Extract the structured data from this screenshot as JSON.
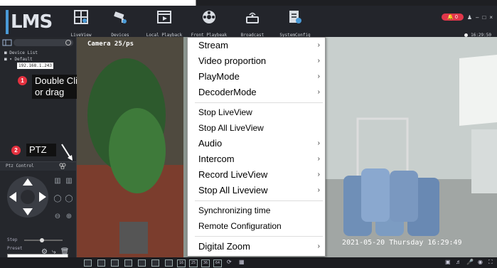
{
  "app": {
    "nav": [
      {
        "label": "LiveView",
        "icon": "liveview-icon"
      },
      {
        "label": "Devices",
        "icon": "camera-devices-icon"
      },
      {
        "label": "Local Playback",
        "icon": "local-playback-icon"
      },
      {
        "label": "Front Playbeak",
        "icon": "front-playback-icon"
      },
      {
        "label": "Broadcast",
        "icon": "broadcast-icon"
      },
      {
        "label": "SystemConfig",
        "icon": "system-config-icon"
      }
    ],
    "alarm_count": "0",
    "clock": "16:29:50"
  },
  "left": {
    "tree_title": "Device List",
    "tree_group": "Default",
    "device_ip": "192.168.1.243",
    "tip1_badge": "1",
    "tip1_text_line1": "Double Click",
    "tip1_text_line2": "or drag",
    "tip2_badge": "2",
    "tip2_text": "PTZ",
    "ptz_title": "Ptz Control",
    "step_label": "Step",
    "preset_label": "Preset"
  },
  "video": {
    "camera_label": "Camera 25/ps",
    "timestamp": "2021-05-20 Thursday 16:29:49"
  },
  "menu": {
    "items": [
      {
        "label": "Stream",
        "submenu": true
      },
      {
        "label": "Video proportion",
        "submenu": true
      },
      {
        "label": "PlayMode",
        "submenu": true
      },
      {
        "label": "DecoderMode",
        "submenu": true
      },
      {
        "label": "Stop LiveView",
        "submenu": false
      },
      {
        "label": "Stop All LiveView",
        "submenu": false
      },
      {
        "label": "Audio",
        "submenu": true
      },
      {
        "label": "Intercom",
        "submenu": true
      },
      {
        "label": "Record LiveView",
        "submenu": true
      },
      {
        "label": "Stop All Liveview",
        "submenu": true
      },
      {
        "label": "Synchronizing time",
        "submenu": false
      },
      {
        "label": "Remote Configuration",
        "submenu": false
      },
      {
        "label": "Digital Zoom",
        "submenu": true
      }
    ]
  },
  "bottombar": {
    "layout_numbers": [
      "16",
      "25",
      "36",
      "64"
    ]
  },
  "colors": {
    "accent_red": "#e5313f",
    "dark_bg": "#1e1f23",
    "logo_blue": "#4a9ad6"
  }
}
